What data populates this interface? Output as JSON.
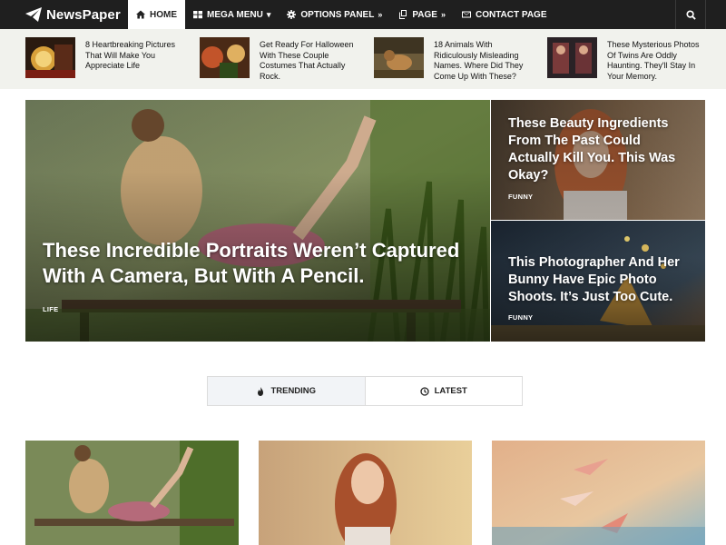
{
  "brand": {
    "name": "NewsPaper"
  },
  "nav": {
    "items": [
      {
        "label": "HOME",
        "icon": "home-icon",
        "active": true
      },
      {
        "label": "MEGA MENU",
        "icon": "grid-icon",
        "arrow": "▾"
      },
      {
        "label": "OPTIONS PANEL",
        "icon": "gear-icon",
        "arrow": "»"
      },
      {
        "label": "PAGE",
        "icon": "copy-icon",
        "arrow": "»"
      },
      {
        "label": "CONTACT PAGE",
        "icon": "envelope-icon"
      }
    ],
    "search_icon": "search-icon"
  },
  "ticker": [
    {
      "title": "8 Heartbreaking Pictures That Will Make You Appreciate Life"
    },
    {
      "title": "Get Ready For Halloween With These Couple Costumes That Actually Rock."
    },
    {
      "title": "18 Animals With Ridiculously Misleading Names. Where Did They Come Up With These?"
    },
    {
      "title": "These Mysterious Photos Of Twins Are Oddly Haunting. They'll Stay In Your Memory."
    }
  ],
  "hero": {
    "main": {
      "title": "These Incredible Portraits Weren’t Captured With A Camera, But With A Pencil.",
      "category": "LIFE"
    },
    "side": [
      {
        "title": "These Beauty Ingredients From The Past Could Actually Kill You. This Was Okay?",
        "category": "FUNNY"
      },
      {
        "title": "This Photographer And Her Bunny Have Epic Photo Shoots. It’s Just Too Cute.",
        "category": "FUNNY"
      }
    ]
  },
  "tabs": [
    {
      "label": "TRENDING",
      "icon": "flame-icon",
      "active": true
    },
    {
      "label": "LATEST",
      "icon": "clock-icon",
      "active": false
    }
  ],
  "colors": {
    "nav_bg": "#1f1f1f",
    "ticker_bg": "#f1f2ed",
    "tab_active_bg": "#f2f4f7"
  }
}
